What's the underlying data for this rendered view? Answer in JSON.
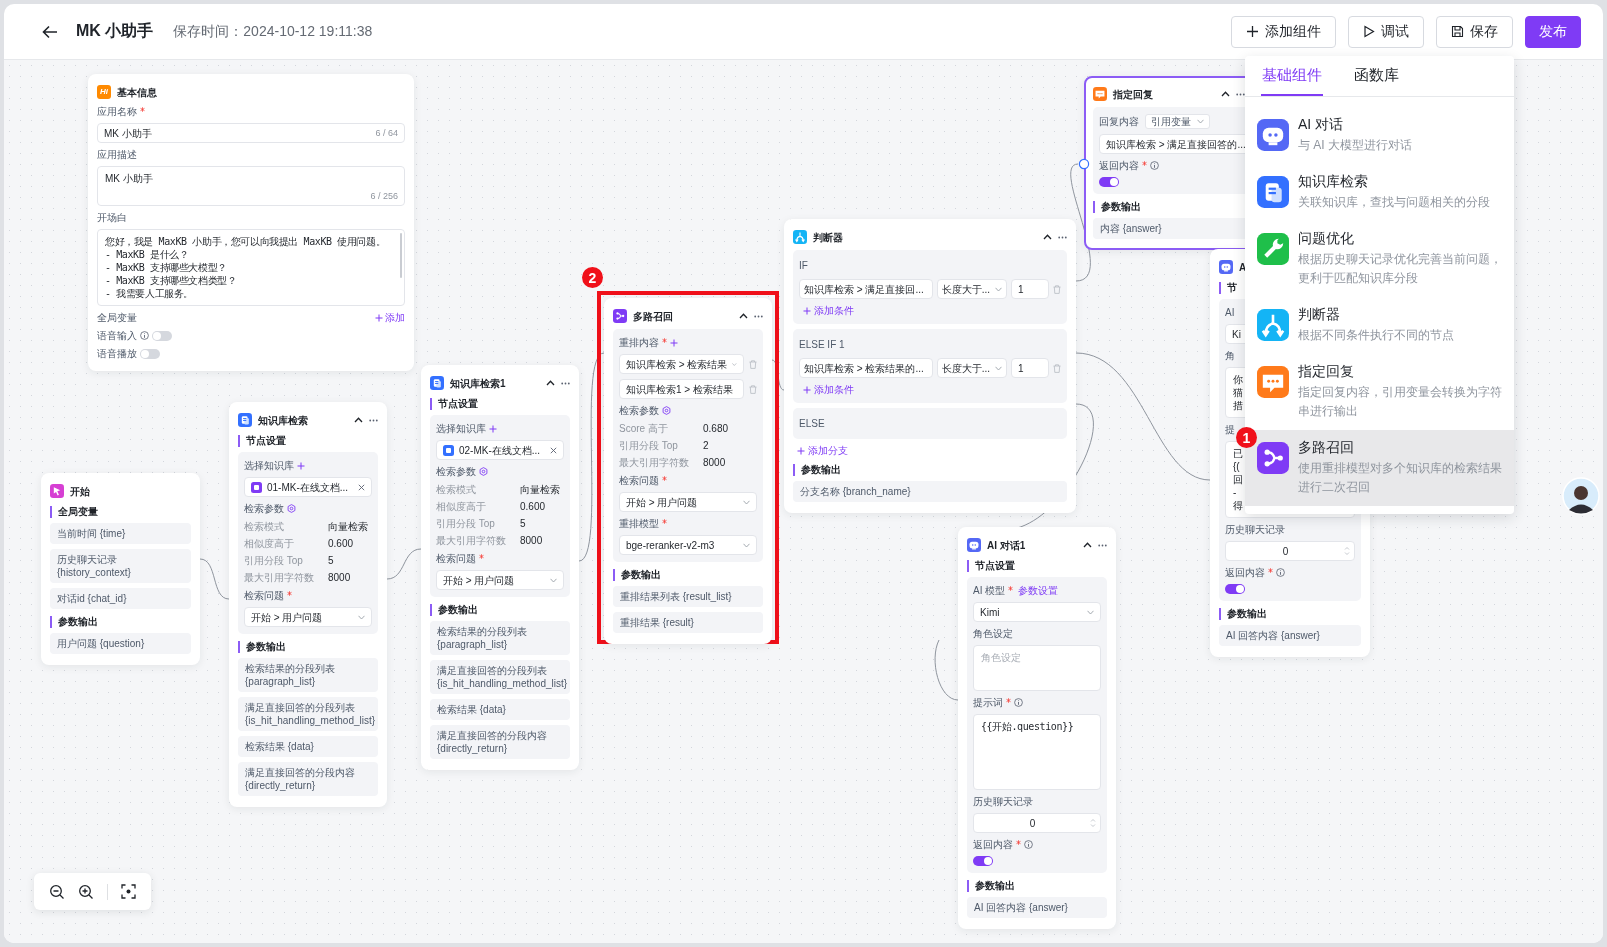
{
  "header": {
    "title": "MK 小助手",
    "saved": "保存时间：2024-10-12 19:11:38",
    "buttons": [
      {
        "label": "添加组件",
        "kind": "add"
      },
      {
        "label": "调试",
        "kind": "debug"
      },
      {
        "label": "保存",
        "kind": "save"
      },
      {
        "label": "发布",
        "kind": "primary"
      }
    ]
  },
  "nodes": [
    {
      "kind": "basic",
      "icon_text": "Hi",
      "title": "基本信息",
      "controls": false,
      "selected": false,
      "highlighted": false,
      "items": [
        {
          "kind": "label",
          "label": "应用名称",
          "required": true
        },
        {
          "kind": "input",
          "value": "MK 小助手",
          "counter": "6 / 64"
        },
        {
          "kind": "label",
          "label": "应用描述"
        },
        {
          "kind": "textarea",
          "lines": [
            "MK 小助手"
          ],
          "counter": "6 / 256"
        },
        {
          "kind": "label",
          "label": "开场白"
        },
        {
          "kind": "textarea",
          "lines": [
            "您好，我是 MaxKB 小助手，您可以向我提出 MaxKB 使用问题。",
            "- MaxKB 是什么？",
            "- MaxKB 支持哪些大模型？",
            "- MaxKB 支持哪些文档类型？",
            "- 我需要人工服务。"
          ],
          "code": true,
          "scrollbar": true
        },
        {
          "kind": "label",
          "label": "全局变量",
          "action": "添加"
        },
        {
          "kind": "toggle",
          "label": "语音输入",
          "info": true,
          "on": false
        },
        {
          "kind": "toggle",
          "label": "语音播放",
          "on": false
        }
      ]
    },
    {
      "kind": "start",
      "title": "开始",
      "controls": false,
      "selected": false,
      "highlighted": false,
      "items": [
        {
          "kind": "section",
          "label": "全局变量"
        },
        {
          "kind": "output",
          "text": "当前时间 {time}"
        },
        {
          "kind": "output",
          "text": "历史聊天记录 {history_context}"
        },
        {
          "kind": "output",
          "text": "对话id {chat_id}"
        },
        {
          "kind": "section",
          "label": "参数输出"
        },
        {
          "kind": "output",
          "text": "用户问题 {question}"
        }
      ]
    },
    {
      "kind": "kb",
      "title": "知识库检索",
      "controls": true,
      "selected": false,
      "highlighted": false,
      "items": [
        {
          "kind": "section",
          "label": "节点设置"
        },
        {
          "kind": "group",
          "children": [
            {
              "kind": "label",
              "label": "选择知识库",
              "add": true
            },
            {
              "kind": "kb",
              "value": "01-MK-在线文档..."
            },
            {
              "kind": "label",
              "label": "检索参数",
              "gear": true
            },
            {
              "kind": "params",
              "rows": [
                {
                  "label": "检索模式",
                  "value": "向量检索"
                },
                {
                  "label": "相似度高于",
                  "value": "0.600"
                },
                {
                  "label": "引用分段 Top",
                  "value": "5"
                },
                {
                  "label": "最大引用字符数",
                  "value": "8000"
                }
              ]
            },
            {
              "kind": "label",
              "label": "检索问题",
              "required": true
            },
            {
              "kind": "select",
              "value": "开始 > 用户问题"
            }
          ]
        },
        {
          "kind": "section",
          "label": "参数输出"
        },
        {
          "kind": "output",
          "text": "检索结果的分段列表 {paragraph_list}"
        },
        {
          "kind": "output",
          "text": "满足直接回答的分段列表 {is_hit_handling_method_list}"
        },
        {
          "kind": "output",
          "text": "检索结果 {data}"
        },
        {
          "kind": "output",
          "text": "满足直接回答的分段内容 {directly_return}"
        }
      ]
    },
    {
      "kind": "kb",
      "title": "知识库检索1",
      "controls": true,
      "selected": false,
      "highlighted": false,
      "items": [
        {
          "kind": "section",
          "label": "节点设置"
        },
        {
          "kind": "group",
          "children": [
            {
              "kind": "label",
              "label": "选择知识库",
              "add": true
            },
            {
              "kind": "kb",
              "value": "02-MK-在线文档..."
            },
            {
              "kind": "label",
              "label": "检索参数",
              "gear": true
            },
            {
              "kind": "params",
              "rows": [
                {
                  "label": "检索模式",
                  "value": "向量检索"
                },
                {
                  "label": "相似度高于",
                  "value": "0.600"
                },
                {
                  "label": "引用分段 Top",
                  "value": "5"
                },
                {
                  "label": "最大引用字符数",
                  "value": "8000"
                }
              ]
            },
            {
              "kind": "label",
              "label": "检索问题",
              "required": true
            },
            {
              "kind": "select",
              "value": "开始 > 用户问题"
            }
          ]
        },
        {
          "kind": "section",
          "label": "参数输出"
        },
        {
          "kind": "output",
          "text": "检索结果的分段列表 {paragraph_list}"
        },
        {
          "kind": "output",
          "text": "满足直接回答的分段列表 {is_hit_handling_method_list}"
        },
        {
          "kind": "output",
          "text": "检索结果 {data}"
        },
        {
          "kind": "output",
          "text": "满足直接回答的分段内容 {directly_return}"
        }
      ]
    },
    {
      "kind": "rerank",
      "title": "多路召回",
      "controls": true,
      "selected": false,
      "highlighted": true,
      "badge": "2",
      "items": [
        {
          "kind": "group",
          "children": [
            {
              "kind": "label",
              "label": "重排内容",
              "required": true,
              "add": true
            },
            {
              "kind": "select",
              "value": "知识库检索 > 检索结果",
              "delete": true
            },
            {
              "kind": "select",
              "value": "知识库检索1 > 检索结果",
              "delete": true
            },
            {
              "kind": "label",
              "label": "检索参数",
              "gear": true
            },
            {
              "kind": "params",
              "rows": [
                {
                  "label": "Score 高于",
                  "value": "0.680"
                },
                {
                  "label": "引用分段 Top",
                  "value": "2"
                },
                {
                  "label": "最大引用字符数",
                  "value": "8000"
                }
              ]
            },
            {
              "kind": "label",
              "label": "检索问题",
              "required": true
            },
            {
              "kind": "select",
              "value": "开始 > 用户问题"
            },
            {
              "kind": "label",
              "label": "重排模型",
              "required": true
            },
            {
              "kind": "select",
              "value": "bge-reranker-v2-m3"
            }
          ]
        },
        {
          "kind": "section",
          "label": "参数输出"
        },
        {
          "kind": "output",
          "text": "重排结果列表 {result_list}"
        },
        {
          "kind": "output",
          "text": "重排结果 {result}"
        }
      ]
    },
    {
      "kind": "condition",
      "title": "判断器",
      "controls": true,
      "selected": false,
      "highlighted": false,
      "items": [
        {
          "kind": "group",
          "children": [
            {
              "kind": "branch",
              "label": "IF"
            },
            {
              "kind": "condition",
              "field": "知识库检索 > 满足直接回...",
              "op": "长度大于...",
              "value": "1"
            },
            {
              "kind": "link",
              "label": "添加条件"
            }
          ]
        },
        {
          "kind": "group",
          "children": [
            {
              "kind": "branch",
              "label": "ELSE IF 1"
            },
            {
              "kind": "condition",
              "field": "知识库检索 > 检索结果的...",
              "op": "长度大于...",
              "value": "1"
            },
            {
              "kind": "link",
              "label": "添加条件"
            }
          ]
        },
        {
          "kind": "group",
          "children": [
            {
              "kind": "branch",
              "label": "ELSE"
            }
          ]
        },
        {
          "kind": "link",
          "label": "添加分支"
        },
        {
          "kind": "section",
          "label": "参数输出"
        },
        {
          "kind": "output",
          "text": "分支名称 {branch_name}"
        }
      ]
    },
    {
      "kind": "reply",
      "title": "指定回复",
      "controls": true,
      "selected": true,
      "highlighted": false,
      "items": [
        {
          "kind": "group",
          "children": [
            {
              "kind": "label",
              "label": "回复内容",
              "select": "引用变量"
            },
            {
              "kind": "select",
              "value": "知识库检索 > 满足直接回答的..."
            },
            {
              "kind": "label",
              "label": "返回内容",
              "required": true,
              "info": true
            },
            {
              "kind": "toggle",
              "on": true
            }
          ]
        },
        {
          "kind": "section",
          "label": "参数输出"
        },
        {
          "kind": "output",
          "text": "内容 {answer}"
        }
      ]
    },
    {
      "kind": "ai",
      "title": "A",
      "controls": false,
      "selected": false,
      "highlighted": false,
      "items": [
        {
          "kind": "section",
          "label": "节"
        },
        {
          "kind": "group",
          "children": [
            {
              "kind": "label",
              "label": "AI"
            },
            {
              "kind": "select",
              "value": "Ki"
            },
            {
              "kind": "label",
              "label": "角"
            },
            {
              "kind": "textarea",
              "lines": [
                "你",
                "猫",
                "措"
              ]
            },
            {
              "kind": "label",
              "label": "提"
            },
            {
              "kind": "textarea",
              "lines": [
                "已",
                "{(",
                "回",
                "-",
                "得"
              ]
            },
            {
              "kind": "label",
              "label": "历史聊天记录"
            },
            {
              "kind": "number",
              "value": "0"
            },
            {
              "kind": "label",
              "label": "返回内容",
              "required": true,
              "info": true
            },
            {
              "kind": "toggle",
              "on": true
            }
          ]
        },
        {
          "kind": "section",
          "label": "参数输出"
        },
        {
          "kind": "output",
          "text": "AI 回答内容 {answer}"
        }
      ]
    },
    {
      "kind": "ai",
      "title": "AI 对话1",
      "controls": true,
      "selected": false,
      "highlighted": false,
      "items": [
        {
          "kind": "section",
          "label": "节点设置"
        },
        {
          "kind": "group",
          "children": [
            {
              "kind": "label",
              "label": "AI 模型",
              "required": true,
              "link": "参数设置"
            },
            {
              "kind": "select",
              "value": "Kimi"
            },
            {
              "kind": "label",
              "label": "角色设定"
            },
            {
              "kind": "textarea",
              "placeholder": "角色设定"
            },
            {
              "kind": "label",
              "label": "提示词",
              "required": true,
              "info": true
            },
            {
              "kind": "textarea",
              "lines": [
                "{{开始.question}}"
              ],
              "code": true
            },
            {
              "kind": "label",
              "label": "历史聊天记录"
            },
            {
              "kind": "number",
              "value": "0"
            },
            {
              "kind": "label",
              "label": "返回内容",
              "required": true,
              "info": true
            },
            {
              "kind": "toggle",
              "on": true
            }
          ]
        },
        {
          "kind": "section",
          "label": "参数输出"
        },
        {
          "kind": "output",
          "text": "AI 回答内容 {answer}"
        }
      ]
    }
  ],
  "popup": {
    "tabs": [
      {
        "label": "基础组件",
        "selected": true
      },
      {
        "label": "函数库",
        "selected": false
      }
    ],
    "items": [
      {
        "kind": "ai",
        "title": "AI 对话",
        "desc": "与 AI 大模型进行对话",
        "selected": false
      },
      {
        "kind": "kb",
        "title": "知识库检索",
        "desc": "关联知识库，查找与问题相关的分段",
        "selected": false
      },
      {
        "kind": "optimize",
        "title": "问题优化",
        "desc": "根据历史聊天记录优化完善当前问题，更利于匹配知识库分段",
        "selected": false
      },
      {
        "kind": "condition",
        "title": "判断器",
        "desc": "根据不同条件执行不同的节点",
        "selected": false
      },
      {
        "kind": "reply",
        "title": "指定回复",
        "desc": "指定回复内容，引用变量会转换为字符串进行输出",
        "selected": false
      },
      {
        "kind": "rerank",
        "title": "多路召回",
        "desc": "使用重排模型对多个知识库的检索结果进行二次召回",
        "selected": true,
        "badge": "1"
      }
    ]
  }
}
